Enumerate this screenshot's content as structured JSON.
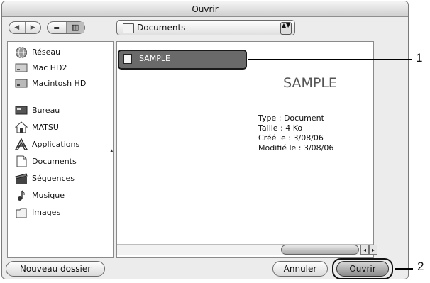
{
  "window": {
    "title": "Ouvrir"
  },
  "toolbar": {
    "back_glyph": "◀",
    "forward_glyph": "▶",
    "list_view_glyph": "≡",
    "column_view_glyph": "▥",
    "location": "Documents",
    "popup_arrows": "▲▼"
  },
  "sidebar": {
    "devices": [
      {
        "label": "Réseau",
        "icon": "network-icon"
      },
      {
        "label": "Mac HD2",
        "icon": "hard-drive-icon"
      },
      {
        "label": "Macintosh HD",
        "icon": "hard-drive-icon"
      }
    ],
    "places": [
      {
        "label": "Bureau",
        "icon": "desktop-icon"
      },
      {
        "label": "MATSU",
        "icon": "home-icon"
      },
      {
        "label": "Applications",
        "icon": "applications-icon"
      },
      {
        "label": "Documents",
        "icon": "document-folder-icon"
      },
      {
        "label": "Séquences",
        "icon": "movies-icon"
      },
      {
        "label": "Musique",
        "icon": "music-icon"
      },
      {
        "label": "Images",
        "icon": "pictures-icon"
      }
    ]
  },
  "browser": {
    "files": [
      {
        "name": "SAMPLE",
        "selected": true
      }
    ]
  },
  "preview": {
    "name": "SAMPLE",
    "type_line": "Type : Document",
    "size_line": "Taille : 4 Ko",
    "created_line": "Créé le : 3/08/06",
    "modified_line": "Modifié le : 3/08/06"
  },
  "scrollbar": {
    "left_glyph": "◂",
    "right_glyph": "▸"
  },
  "buttons": {
    "new_folder": "Nouveau dossier",
    "cancel": "Annuler",
    "open": "Ouvrir"
  },
  "callouts": {
    "one": "1",
    "two": "2"
  }
}
